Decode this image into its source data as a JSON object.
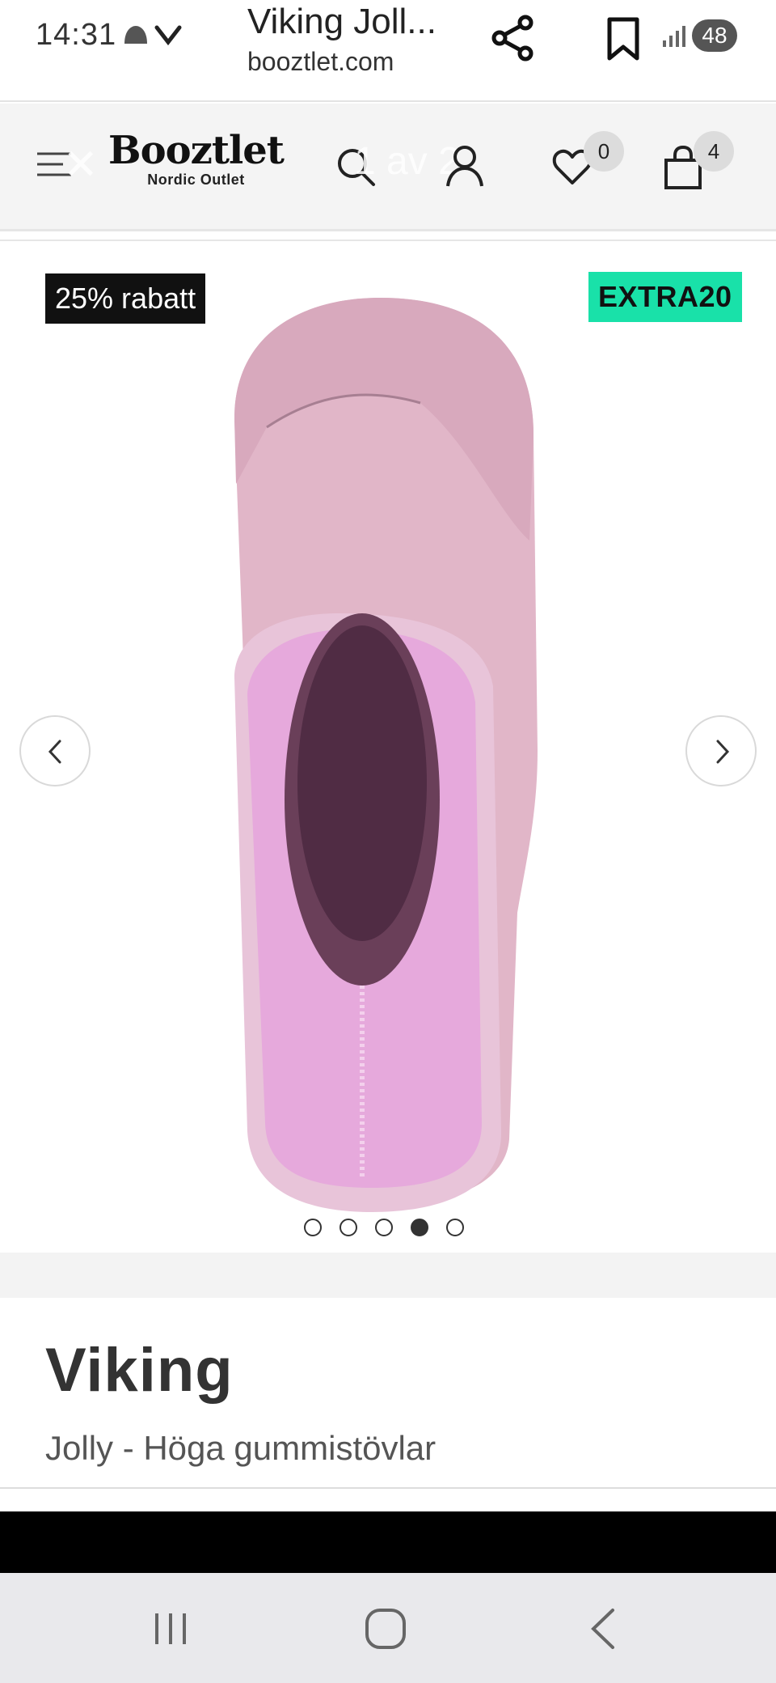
{
  "status_bar": {
    "time": "14:31",
    "battery": "48"
  },
  "browser": {
    "tab_title": "Viking Joll...",
    "url": "booztlet.com"
  },
  "site": {
    "logo_text": "Booztlet",
    "logo_sub": "Nordic Outlet",
    "overlay_counter": "1 av 2",
    "wishlist_count": "0",
    "cart_count": "4"
  },
  "gallery": {
    "discount_badge": "25% rabatt",
    "code_badge": "EXTRA20",
    "image_count": 5,
    "active_image_index": 4
  },
  "product": {
    "brand": "Viking",
    "name": "Jolly - Höga gummistövlar"
  },
  "colors": {
    "code_badge_bg": "#19e1a9",
    "discount_badge_bg": "#111111",
    "boot_outer": "#e3b8cc",
    "boot_lining": "#e8a8d8"
  },
  "icons": {
    "share": "share-icon",
    "bookmark": "bookmark-icon",
    "menu": "menu-icon",
    "search": "search-icon",
    "account": "user-icon",
    "wishlist": "heart-icon",
    "bag": "shopping-bag-icon",
    "prev": "chevron-left-icon",
    "next": "chevron-right-icon"
  }
}
